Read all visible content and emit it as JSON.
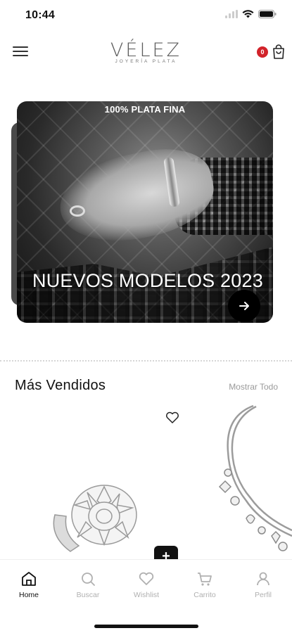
{
  "status": {
    "time": "10:44"
  },
  "header": {
    "logo_main": "VÉLEZ",
    "logo_sub": "JOYERÍA PLATA",
    "cart_count": "0"
  },
  "banner": {
    "tag": "100% PLATA FINA",
    "title": "NUEVOS MODELOS 2023"
  },
  "best_sellers": {
    "title": "Más Vendidos",
    "show_all": "Mostrar Todo",
    "add_label": "+"
  },
  "nav": {
    "items": [
      {
        "label": "Home",
        "icon": "home-icon",
        "active": true
      },
      {
        "label": "Buscar",
        "icon": "search-icon",
        "active": false
      },
      {
        "label": "Wishlist",
        "icon": "heart-icon",
        "active": false
      },
      {
        "label": "Carrito",
        "icon": "cart-icon",
        "active": false
      },
      {
        "label": "Perfil",
        "icon": "user-icon",
        "active": false
      }
    ]
  },
  "colors": {
    "badge": "#d2232a",
    "accent": "#111111",
    "inactive": "#b0b0b0"
  }
}
